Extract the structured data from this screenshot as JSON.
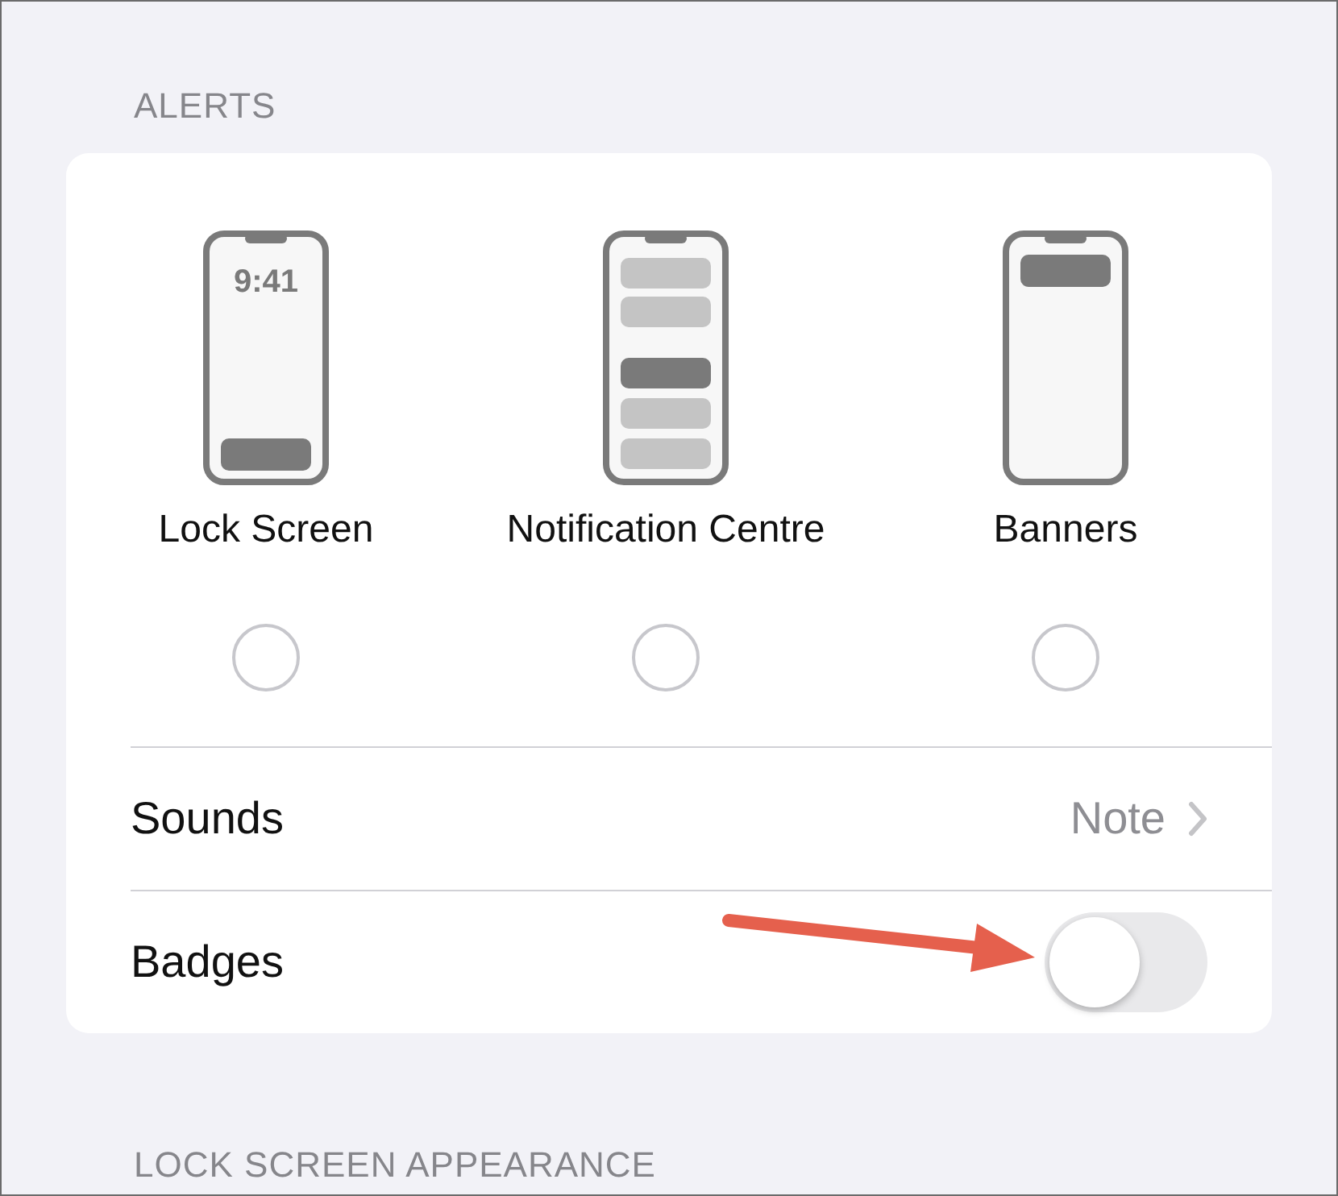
{
  "section_header": "ALERTS",
  "alert_styles": [
    {
      "kind": "lock_screen",
      "label": "Lock Screen",
      "clock": "9:41",
      "selected": false
    },
    {
      "kind": "notification_centre",
      "label": "Notification Centre",
      "selected": false
    },
    {
      "kind": "banners",
      "label": "Banners",
      "selected": false
    }
  ],
  "rows": [
    {
      "kind": "value",
      "label": "Sounds",
      "value": "Note"
    },
    {
      "kind": "toggle",
      "label": "Badges",
      "on": false
    }
  ],
  "next_section_header": "LOCK SCREEN APPEARANCE"
}
